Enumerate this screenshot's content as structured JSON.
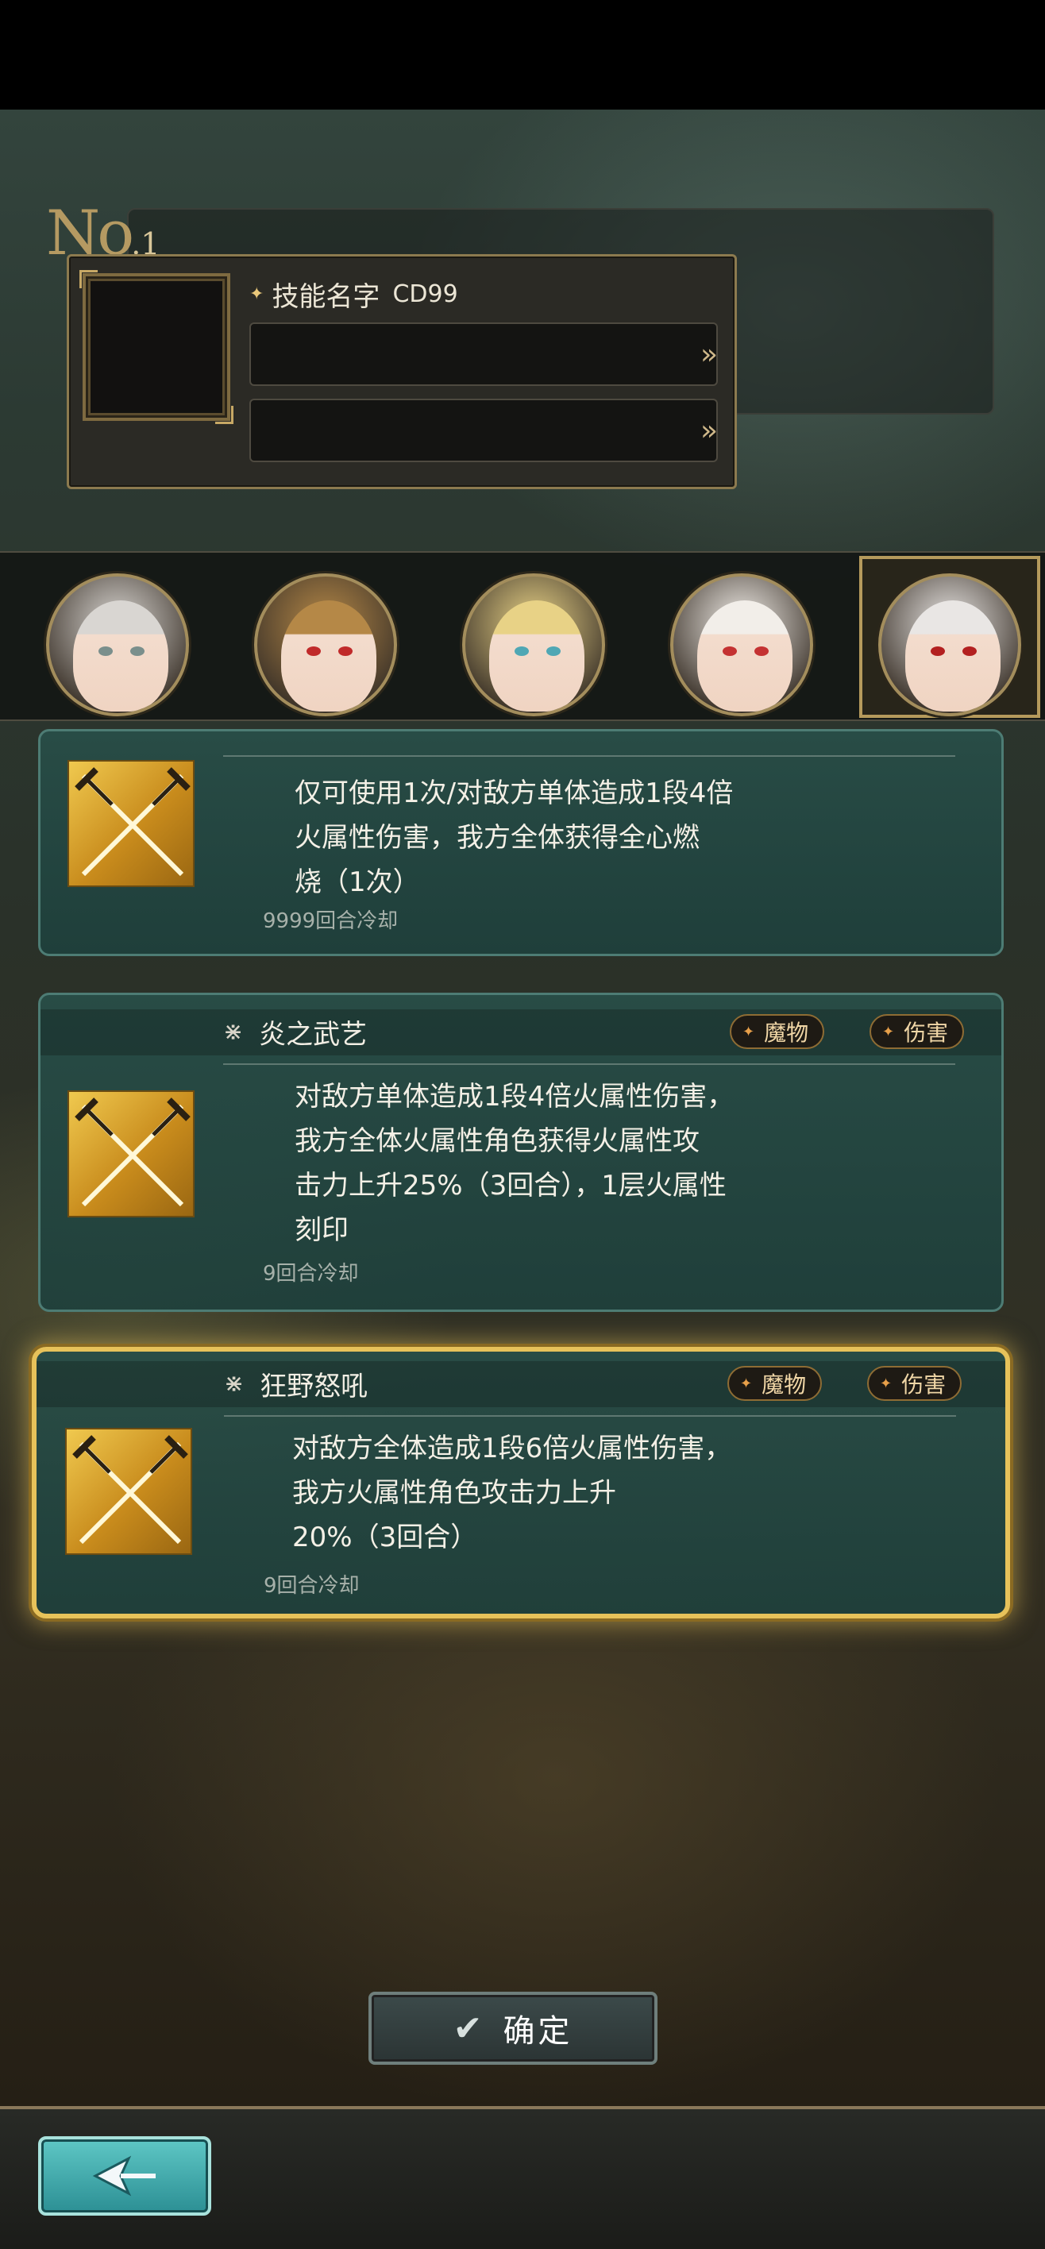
{
  "header": {
    "no_prefix": "No",
    "no_number": ".1"
  },
  "selected_skill": {
    "name": "技能名字",
    "cd": "CD99",
    "slots": [
      {
        "arrow": "»"
      },
      {
        "arrow": "»"
      }
    ]
  },
  "characters": [
    {
      "name": "character-1",
      "hair": "#d9d6d2",
      "eye": "#7a8f8c",
      "selected": false
    },
    {
      "name": "character-2",
      "hair": "#b58847",
      "eye": "#c02a2a",
      "selected": false
    },
    {
      "name": "character-3",
      "hair": "#e8d286",
      "eye": "#4fa7b4",
      "selected": false
    },
    {
      "name": "character-4",
      "hair": "#f2eee9",
      "eye": "#c43232",
      "selected": false
    },
    {
      "name": "character-5",
      "hair": "#e9e6e4",
      "eye": "#b32020",
      "selected": true
    }
  ],
  "skills": [
    {
      "name": "",
      "description": [
        "仅可使用1次/对敌方单体造成1段4倍",
        "火属性伤害，我方全体获得全心燃",
        "烧（1次）"
      ],
      "cooldown": "9999回合冷却",
      "tags": []
    },
    {
      "name": "炎之武艺",
      "description": [
        "对敌方单体造成1段4倍火属性伤害，",
        "我方全体火属性角色获得火属性攻",
        "击力上升25%（3回合），1层火属性",
        "刻印"
      ],
      "cooldown": "9回合冷却",
      "tags": [
        "魔物",
        "伤害"
      ]
    },
    {
      "name": "狂野怒吼",
      "description": [
        "对敌方全体造成1段6倍火属性伤害，",
        "我方火属性角色攻击力上升",
        "20%（3回合）"
      ],
      "cooldown": "9回合冷却",
      "tags": [
        "魔物",
        "伤害"
      ],
      "selected": true
    }
  ],
  "footer": {
    "confirm_label": "确定",
    "confirm_icon": "check-icon",
    "back_icon": "back-arrow-icon"
  },
  "colors": {
    "gold": "#e7c25a",
    "card_bg": "#2a5550",
    "teal_button": "#3fb0b2"
  }
}
